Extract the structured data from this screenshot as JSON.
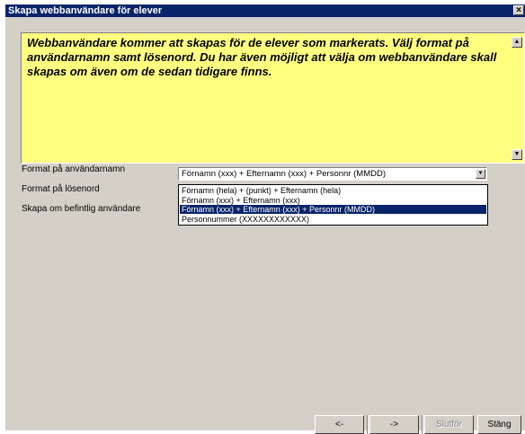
{
  "window": {
    "title": "Skapa webbanvändare för elever",
    "close_glyph": "×"
  },
  "info": {
    "text": "Webbanvändare kommer att skapas för de elever som markerats. Välj format på användarnamn samt lösenord. Du har även möjligt att välja om webbanvändare skall skapas om även om de sedan tidigare finns."
  },
  "form": {
    "username_label": "Format på användarnamn",
    "password_label": "Format på lösenord",
    "recreate_label": "Skapa om befintlig användare",
    "username_value": "Förnamn (xxx) + Efternamn (xxx) + Personnr (MMDD)"
  },
  "dropdown": {
    "options": [
      "Förnamn (hela) + (punkt) + Efternamn (hela)",
      "Förnamn (xxx) + Efternamn (xxx)",
      "Förnamn (xxx) + Efternamn (xxx) + Personnr (MMDD)",
      "Personnummer (XXXXXXXXXXXX)"
    ],
    "selected_index": 2
  },
  "buttons": {
    "back": "<-",
    "next": "->",
    "finish": "Slutför",
    "close": "Stäng"
  },
  "colors": {
    "titlebar": "#0a246a",
    "info_background": "#ffff80",
    "window_background": "#d4d0c8",
    "selection": "#0a246a"
  }
}
